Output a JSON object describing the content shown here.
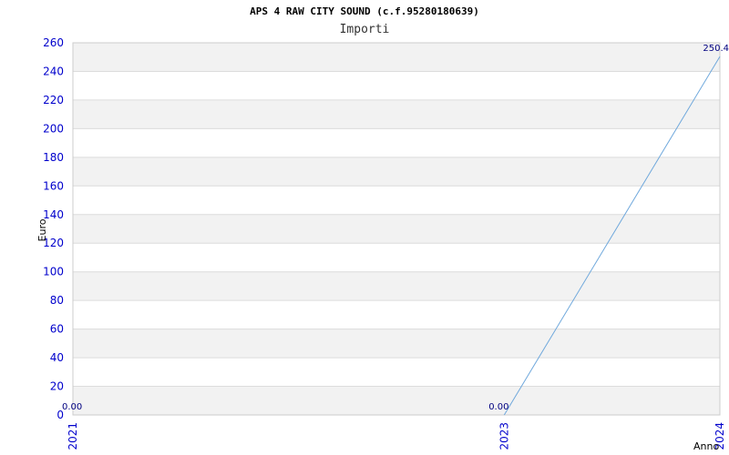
{
  "page": {
    "title": "APS 4 RAW CITY SOUND (c.f.95280180639)",
    "subtitle": "Importi"
  },
  "chart_data": {
    "type": "line",
    "title": "APS 4 RAW CITY SOUND (c.f.95280180639)",
    "subtitle": "Importi",
    "xlabel": "Anno",
    "ylabel": "Euro",
    "x": [
      "2021",
      "2023",
      "2024"
    ],
    "series": [
      {
        "values": [
          0.0,
          0.0,
          250.4
        ],
        "labels": [
          "0.00",
          "0.00",
          "250.4"
        ]
      }
    ],
    "ylim": [
      0,
      260
    ],
    "yticks": [
      0,
      20,
      40,
      60,
      80,
      100,
      120,
      140,
      160,
      180,
      200,
      220,
      240,
      260
    ],
    "grid": true,
    "colors": {
      "line": "#6fa8dc",
      "tick_text": "#0000cc",
      "band": "#f2f2f2",
      "grid": "#dcdcdc",
      "label_text": "#000080"
    }
  }
}
